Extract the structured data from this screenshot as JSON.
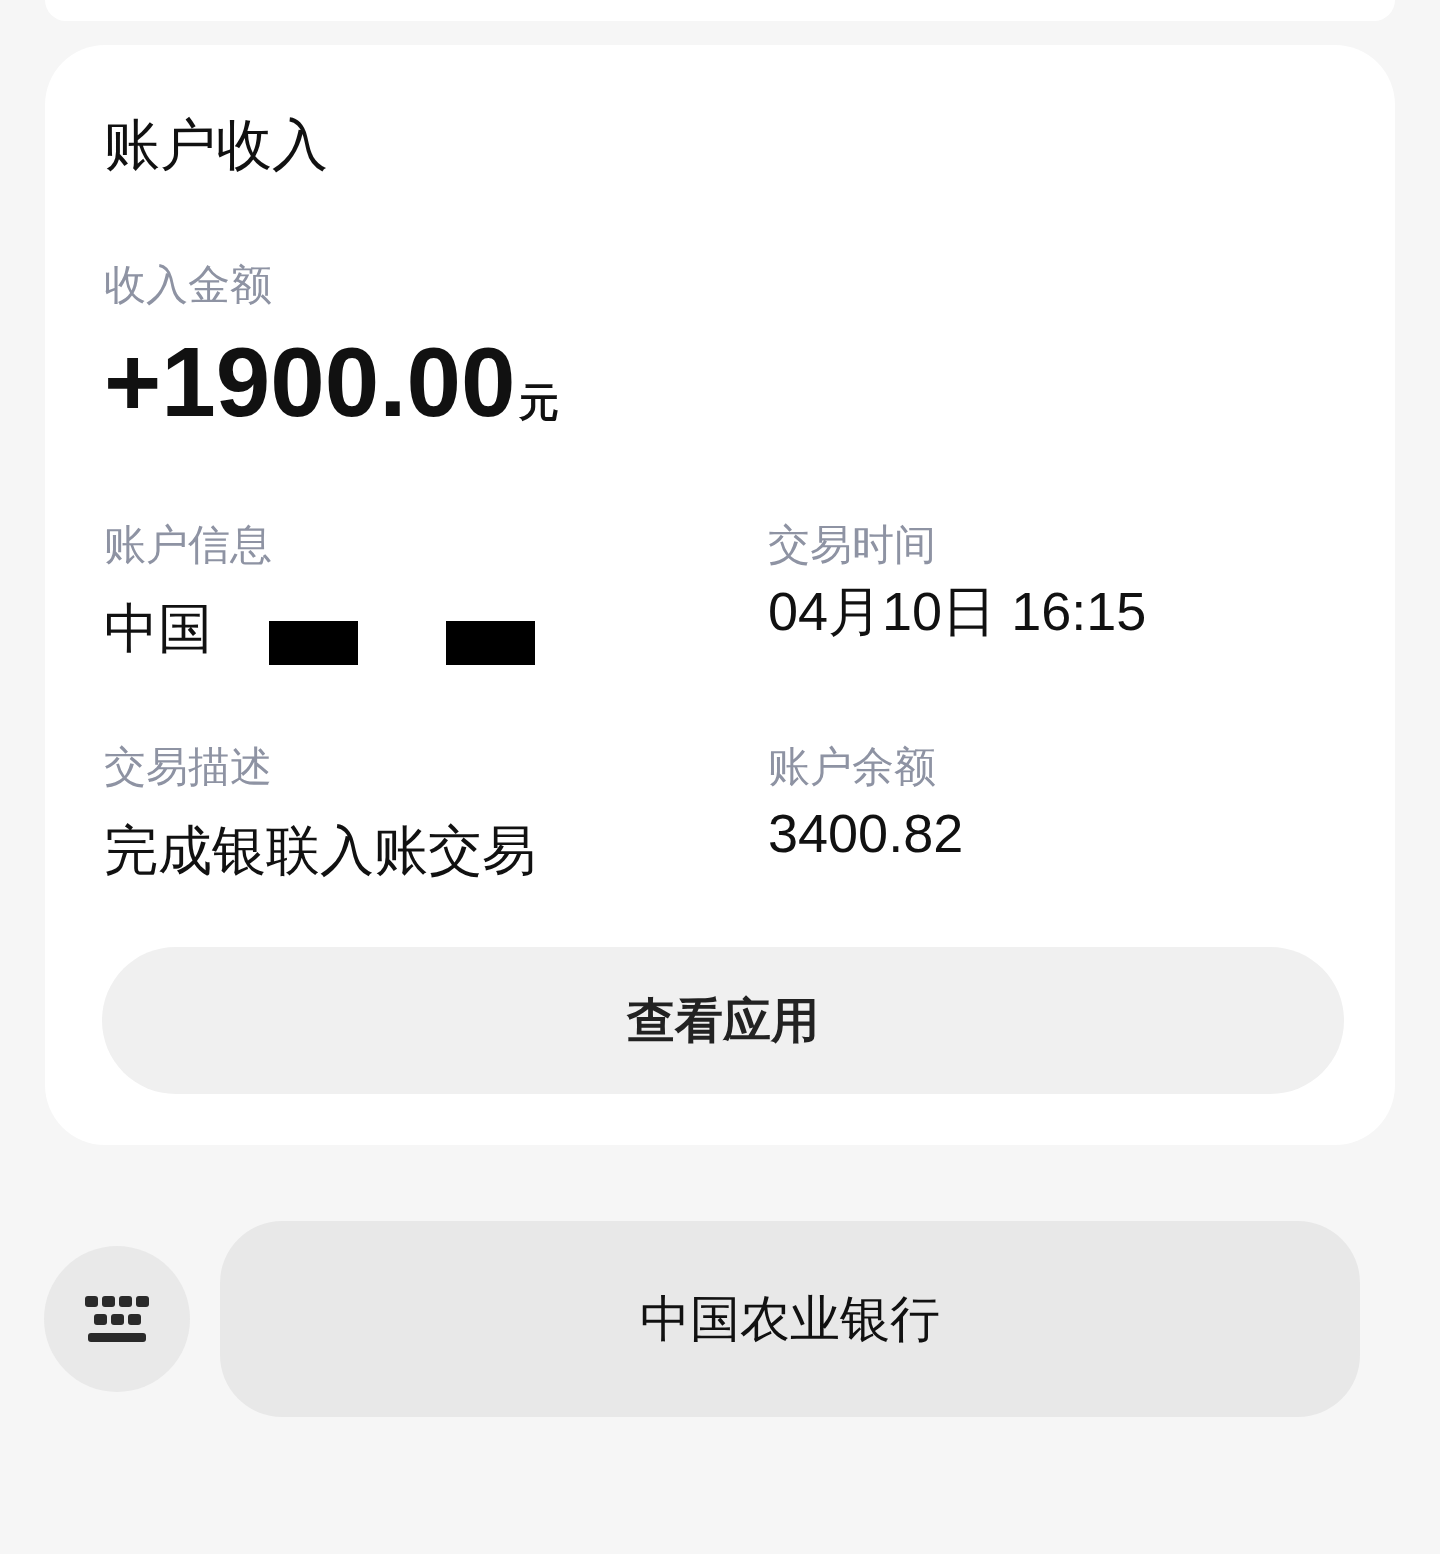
{
  "card": {
    "title": "账户收入",
    "amount": {
      "label": "收入金额",
      "value": "+1900.00",
      "unit": "元"
    },
    "fields": [
      {
        "label": "账户信息",
        "value": "中国",
        "redacted": true
      },
      {
        "label": "交易时间",
        "value": "04月10日 16:15",
        "redacted": false
      },
      {
        "label": "交易描述",
        "value": "完成银联入账交易",
        "redacted": false
      },
      {
        "label": "账户余额",
        "value": "3400.82",
        "redacted": false
      }
    ],
    "button": "查看应用"
  },
  "footer": {
    "label": "中国农业银行"
  }
}
